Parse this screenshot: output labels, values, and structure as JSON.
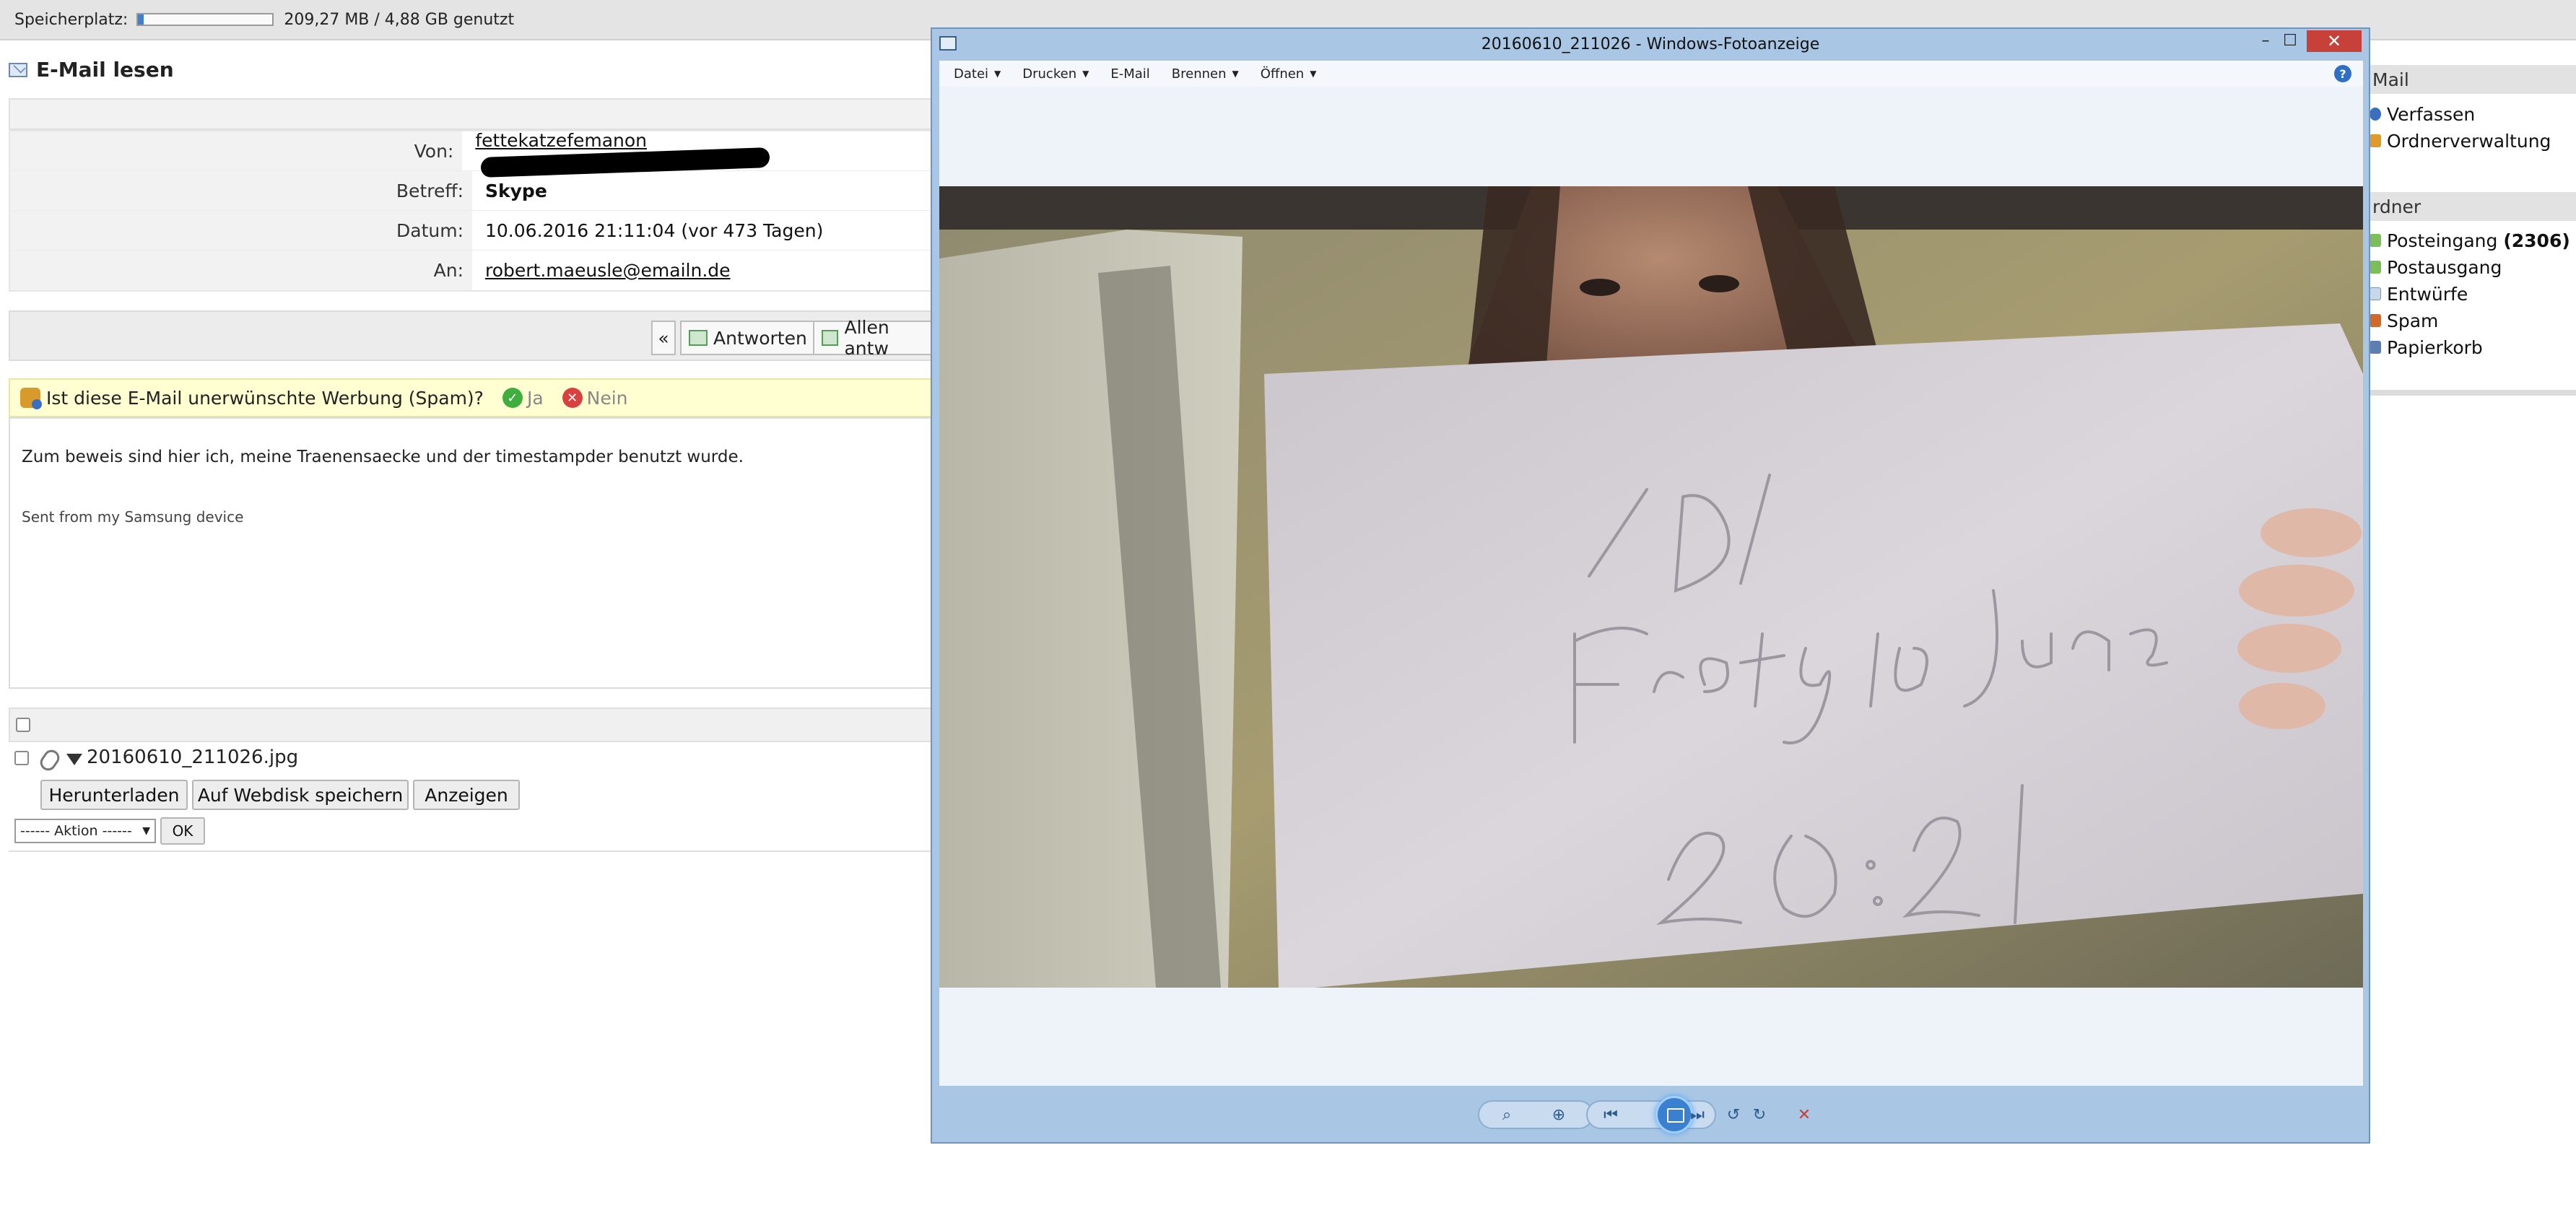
{
  "storage": {
    "label": "Speicherplatz:",
    "usage": "209,27 MB / 4,88 GB genutzt",
    "fill_fraction": 0.04
  },
  "mail": {
    "title": "E-Mail lesen",
    "fields": [
      {
        "label": "Von:",
        "value": "fettekatzefemanon"
      },
      {
        "label": "Betreff:",
        "value": "Skype"
      },
      {
        "label": "Datum:",
        "value": "10.06.2016 21:11:04 (vor 473 Tagen)"
      },
      {
        "label": "An:",
        "value": "robert.maeusle@emailn.de"
      }
    ],
    "toolbar": {
      "back": "«",
      "reply": "Antworten",
      "reply_all": "Allen antw"
    },
    "spam": {
      "question": "Ist diese E-Mail unerwünschte Werbung (Spam)?",
      "yes": "Ja",
      "no": "Nein"
    },
    "body": "Zum beweis sind hier ich, meine Traenensaecke und der timestampder benutzt wurde.",
    "signature": "Sent from my Samsung device",
    "attachment": {
      "filename": "20160610_211026.jpg",
      "buttons": [
        "Herunterladen",
        "Auf Webdisk speichern",
        "Anzeigen"
      ],
      "action_select": "------ Aktion ------",
      "ok": "OK"
    }
  },
  "sidebar": {
    "heading1": "Mail",
    "actions": [
      "Verfassen",
      "Ordnerverwaltung"
    ],
    "heading2": "rdner",
    "folders": [
      {
        "name": "Posteingang",
        "count": "(2306)"
      },
      {
        "name": "Postausgang"
      },
      {
        "name": "Entwürfe"
      },
      {
        "name": "Spam"
      },
      {
        "name": "Papierkorb"
      }
    ]
  },
  "viewer": {
    "title": "20160610_211026 - Windows-Fotoanzeige",
    "menu": [
      {
        "label": "Datei",
        "caret": true
      },
      {
        "label": "Drucken",
        "caret": true
      },
      {
        "label": "E-Mail",
        "caret": false
      },
      {
        "label": "Brennen",
        "caret": true
      },
      {
        "label": "Öffnen",
        "caret": true
      }
    ],
    "help": "?",
    "photo_text": {
      "line1": "/D/",
      "line2": "Freitag 10 June",
      "line3": "20:21"
    }
  },
  "colors": {
    "accent": "#3a7fd0",
    "spam_bg": "#ffffd2",
    "close": "#c7413a",
    "viewer_frame": "#a9c6e4"
  }
}
